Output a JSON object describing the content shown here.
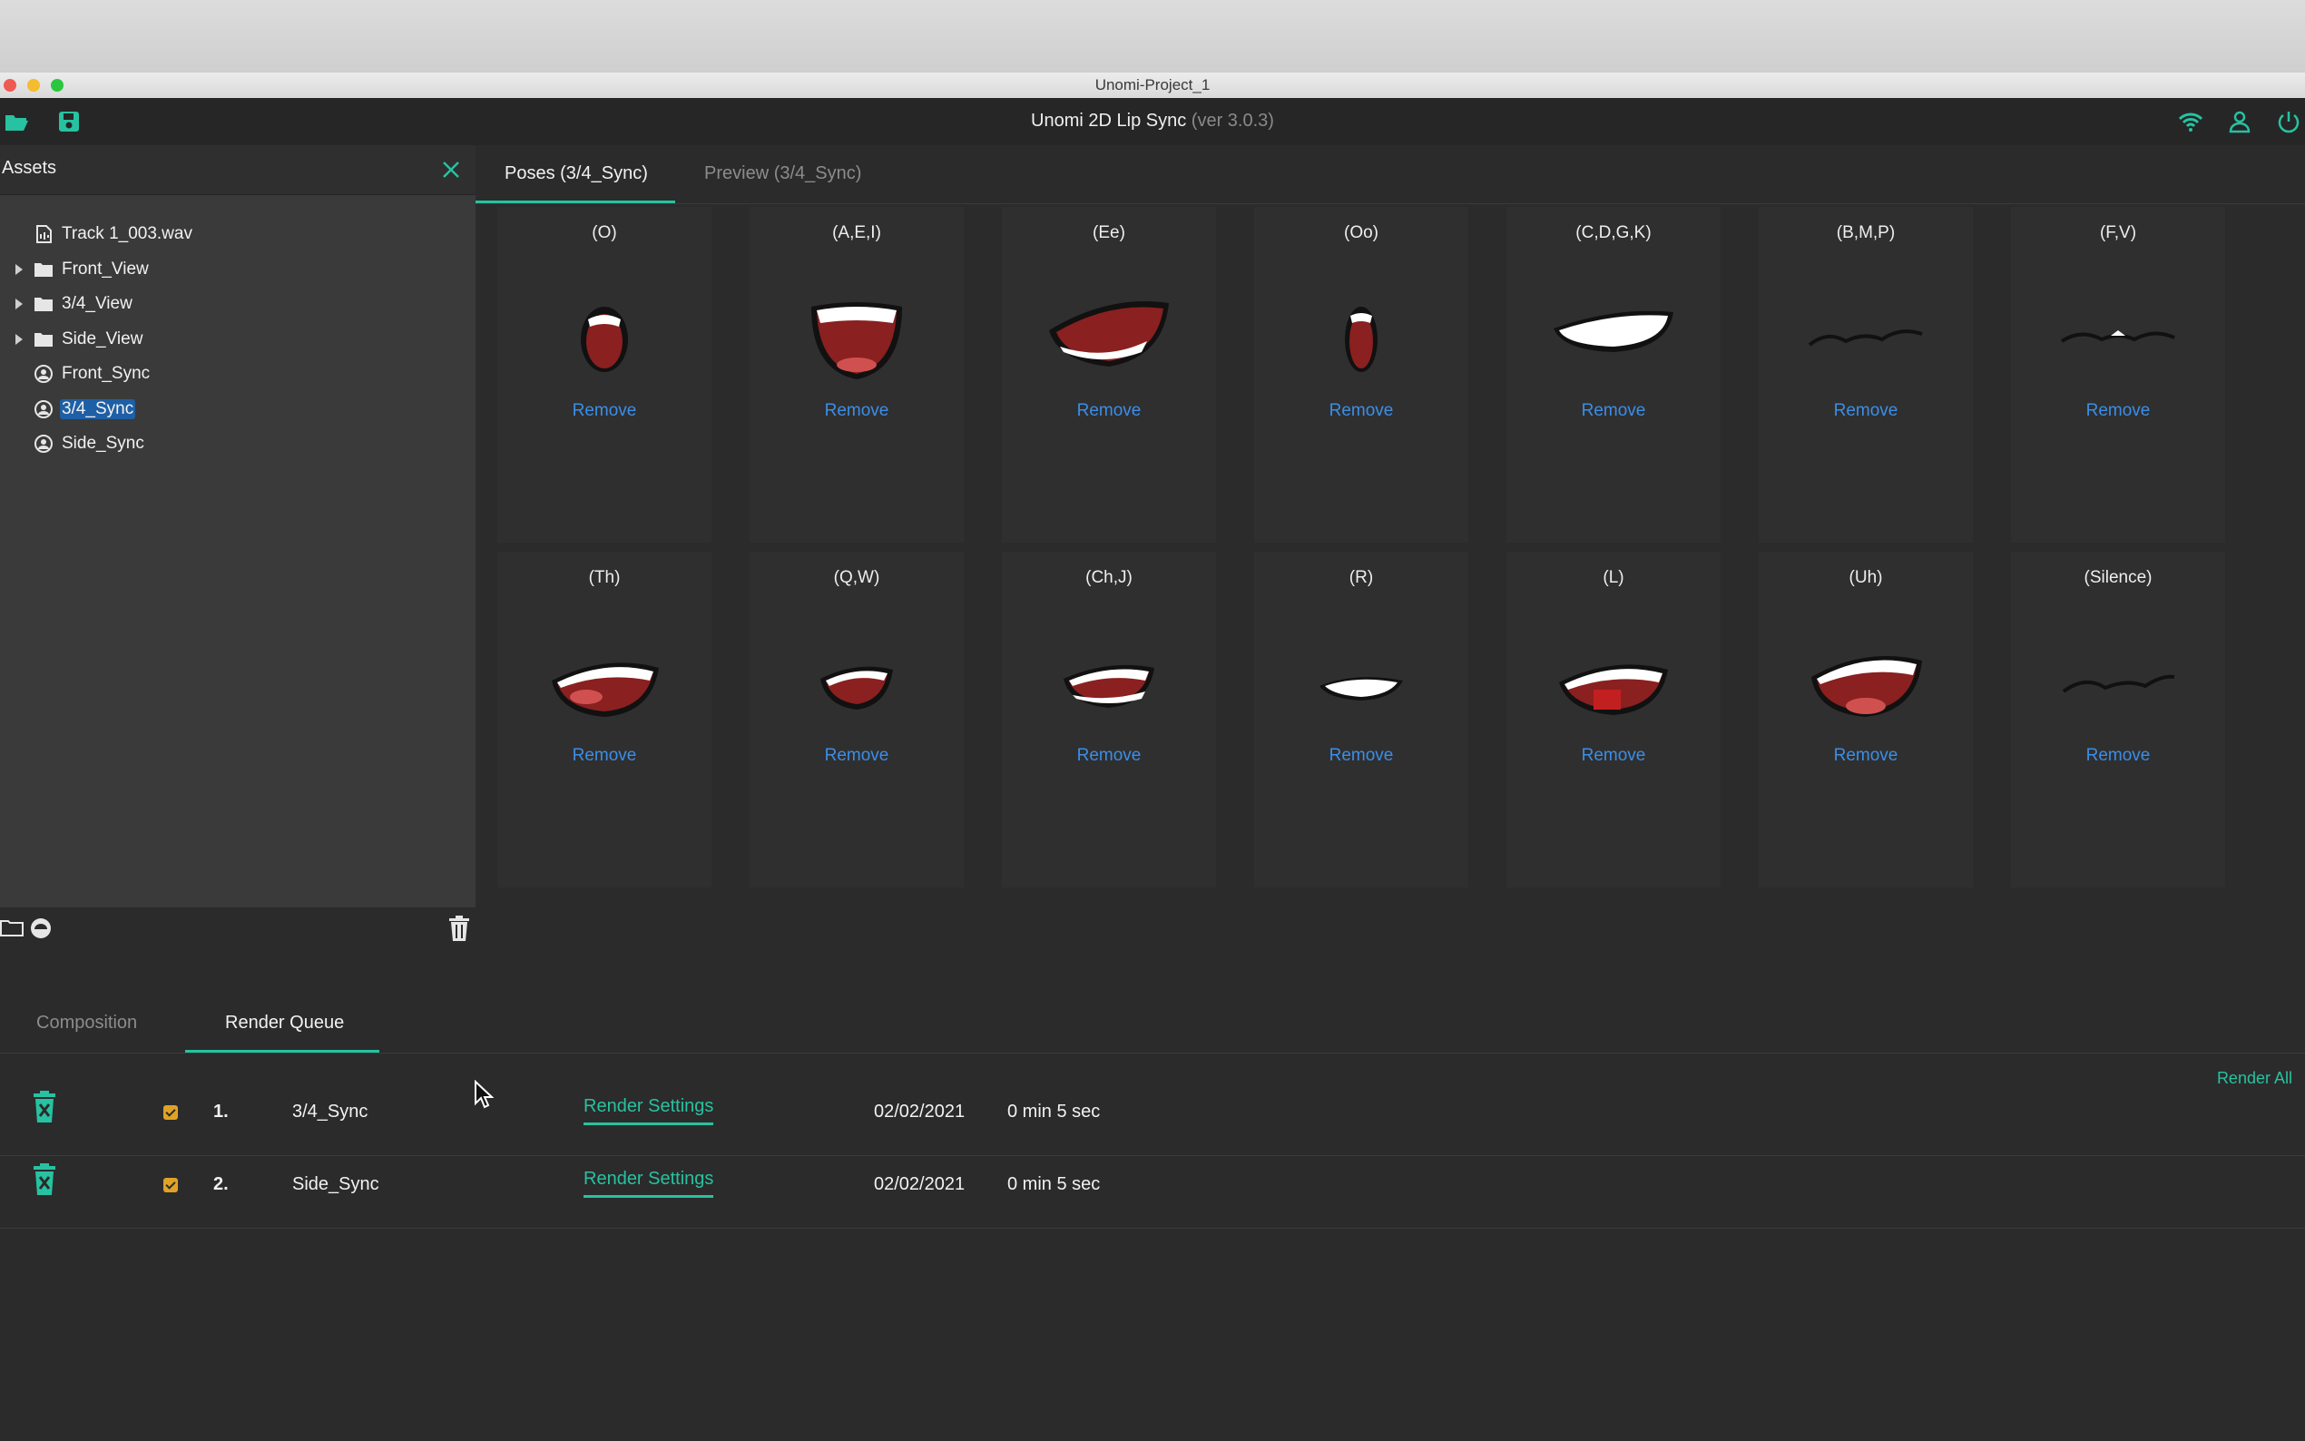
{
  "window": {
    "title": "Unomi-Project_1"
  },
  "header": {
    "app_name": "Unomi 2D Lip Sync",
    "version": "(ver 3.0.3)",
    "icons": [
      "open-folder-icon",
      "save-icon",
      "wifi-icon",
      "user-icon",
      "power-icon"
    ]
  },
  "assets": {
    "title": "Assets",
    "items": [
      {
        "label": "Track 1_003.wav",
        "icon": "audio-file-icon",
        "expandable": false,
        "selected": false
      },
      {
        "label": "Front_View",
        "icon": "folder-icon",
        "expandable": true,
        "selected": false
      },
      {
        "label": "3/4_View",
        "icon": "folder-icon",
        "expandable": true,
        "selected": false
      },
      {
        "label": "Side_View",
        "icon": "folder-icon",
        "expandable": true,
        "selected": false
      },
      {
        "label": "Front_Sync",
        "icon": "sync-person-icon",
        "expandable": false,
        "selected": false
      },
      {
        "label": "3/4_Sync",
        "icon": "sync-person-icon",
        "expandable": false,
        "selected": true
      },
      {
        "label": "Side_Sync",
        "icon": "sync-person-icon",
        "expandable": false,
        "selected": false
      }
    ]
  },
  "poses_tabs": [
    {
      "label": "Poses (3/4_Sync)",
      "active": true
    },
    {
      "label": "Preview (3/4_Sync)",
      "active": false
    }
  ],
  "poses": [
    {
      "label": "(O)",
      "remove": "Remove"
    },
    {
      "label": "(A,E,I)",
      "remove": "Remove"
    },
    {
      "label": "(Ee)",
      "remove": "Remove"
    },
    {
      "label": "(Oo)",
      "remove": "Remove"
    },
    {
      "label": "(C,D,G,K)",
      "remove": "Remove"
    },
    {
      "label": "(B,M,P)",
      "remove": "Remove"
    },
    {
      "label": "(F,V)",
      "remove": "Remove"
    },
    {
      "label": "(Th)",
      "remove": "Remove"
    },
    {
      "label": "(Q,W)",
      "remove": "Remove"
    },
    {
      "label": "(Ch,J)",
      "remove": "Remove"
    },
    {
      "label": "(R)",
      "remove": "Remove"
    },
    {
      "label": "(L)",
      "remove": "Remove"
    },
    {
      "label": "(Uh)",
      "remove": "Remove"
    },
    {
      "label": "(Silence)",
      "remove": "Remove"
    }
  ],
  "bottom_tabs": [
    {
      "label": "Composition",
      "active": false
    },
    {
      "label": "Render Queue",
      "active": true
    }
  ],
  "render_all": "Render All",
  "render_queue": [
    {
      "number": "1.",
      "name": "3/4_Sync",
      "settings": "Render Settings",
      "date": "02/02/2021",
      "duration": "0 min 5 sec",
      "checked": true
    },
    {
      "number": "2.",
      "name": "Side_Sync",
      "settings": "Render Settings",
      "date": "02/02/2021",
      "duration": "0 min 5 sec",
      "checked": true
    }
  ],
  "colors": {
    "accent": "#27c2a1",
    "link": "#3b8ee8",
    "checkbox": "#e0a226",
    "selection": "#1f5fa5"
  }
}
